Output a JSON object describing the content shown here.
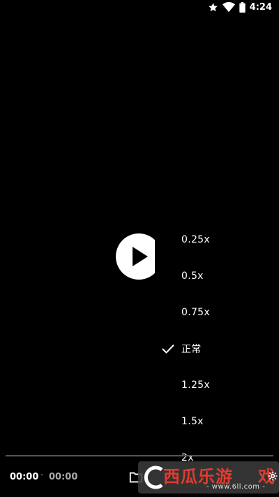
{
  "status_bar": {
    "time": "4:24",
    "icons": [
      "star-icon",
      "wifi-icon",
      "battery-icon"
    ]
  },
  "player": {
    "state": "paused",
    "play_icon": "play-icon"
  },
  "speed_menu": {
    "items": [
      {
        "label": "0.25x",
        "selected": false
      },
      {
        "label": "0.5x",
        "selected": false
      },
      {
        "label": "0.75x",
        "selected": false
      },
      {
        "label": "正常",
        "selected": true
      },
      {
        "label": "1.25x",
        "selected": false
      },
      {
        "label": "1.5x",
        "selected": false
      },
      {
        "label": "2x",
        "selected": false
      }
    ]
  },
  "controls": {
    "current_time": "00:00",
    "separator": "·",
    "total_time": "00:00",
    "icons": [
      "folder-icon",
      "settings-icon"
    ]
  },
  "watermark": {
    "brand": "西瓜乐游",
    "brand_suffix": "戏",
    "url": "- www.6ll.com -"
  },
  "colors": {
    "background": "#000000",
    "accent": "#e23b2e"
  }
}
